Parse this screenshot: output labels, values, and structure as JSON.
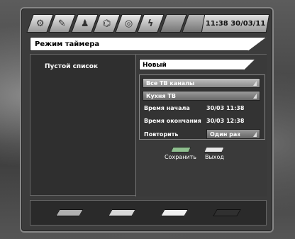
{
  "header": {
    "tabs": [
      {
        "icon": "gear-icon",
        "glyph": "⚙"
      },
      {
        "icon": "wrench-icon",
        "glyph": "✎"
      },
      {
        "icon": "user-icon",
        "glyph": "♟"
      },
      {
        "icon": "dish-icon",
        "glyph": "⌬"
      },
      {
        "icon": "disc-icon",
        "glyph": "◎"
      },
      {
        "icon": "lightning-icon",
        "glyph": "ϟ"
      },
      {
        "icon": "blank-tab",
        "glyph": ""
      },
      {
        "icon": "blank-tab",
        "glyph": ""
      }
    ],
    "clock": "11:38  30/03/11"
  },
  "title": "Режим таймера",
  "main": {
    "empty_list": "Пустой список"
  },
  "timer_panel": {
    "mode": "Новый",
    "channel_group": "Все ТВ каналы",
    "channel": "Кухня ТВ",
    "start_label": "Время начала",
    "start_value": "30/03 11:38",
    "end_label": "Время окончания",
    "end_value": "30/03 12:38",
    "repeat_label": "Повторить",
    "repeat_value": "Один раз",
    "actions": [
      {
        "label": "Сохранить",
        "color": "#8fbf8f"
      },
      {
        "label": "Выход",
        "color": "#e8e8e8"
      }
    ]
  },
  "footer": {
    "keys": [
      {
        "name": "red-key",
        "color": "#b0b0b0"
      },
      {
        "name": "green-key",
        "color": "#d8d8d8"
      },
      {
        "name": "yellow-key",
        "color": "#f0f0f0"
      },
      {
        "name": "blue-key",
        "color": "#303030"
      }
    ]
  }
}
